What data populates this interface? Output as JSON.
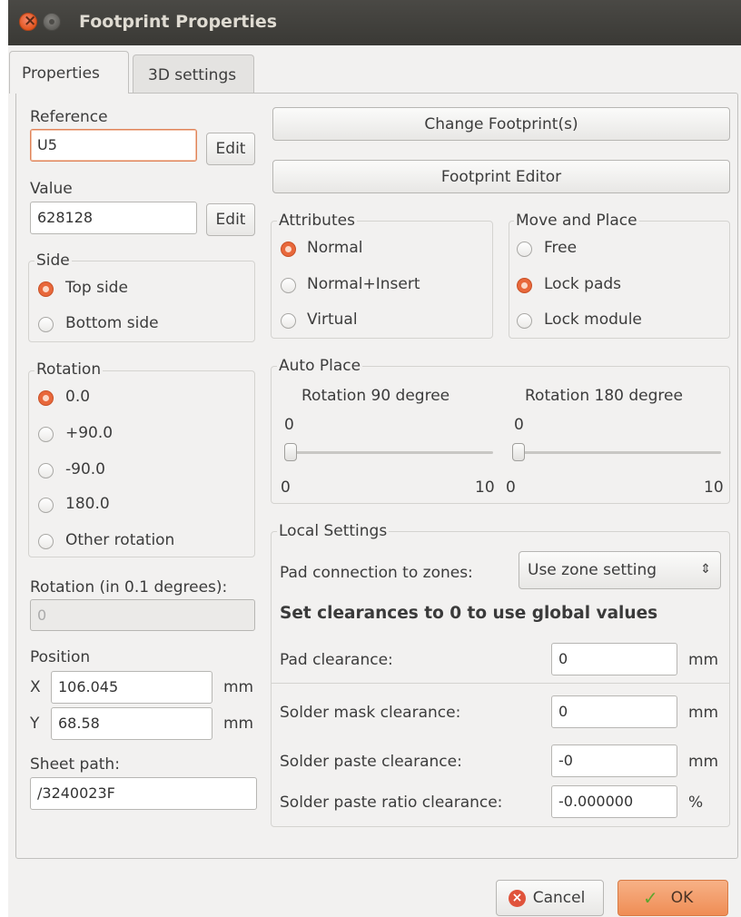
{
  "window": {
    "title": "Footprint Properties"
  },
  "tabs": [
    {
      "label": "Properties"
    },
    {
      "label": "3D settings"
    }
  ],
  "left": {
    "reference_label": "Reference",
    "reference_value": "U5",
    "reference_edit": "Edit",
    "value_label": "Value",
    "value_value": "628128",
    "value_edit": "Edit",
    "side": {
      "title": "Side",
      "options": [
        "Top side",
        "Bottom side"
      ],
      "selected": "Top side"
    },
    "rotation": {
      "title": "Rotation",
      "options": [
        "0.0",
        "+90.0",
        "-90.0",
        "180.0",
        "Other rotation"
      ],
      "selected": "0.0"
    },
    "rotation_custom_label": "Rotation (in 0.1 degrees):",
    "rotation_custom_value": "0",
    "position_label": "Position",
    "pos_x_label": "X",
    "pos_x_value": "106.045",
    "pos_x_unit": "mm",
    "pos_y_label": "Y",
    "pos_y_value": "68.58",
    "pos_y_unit": "mm",
    "sheet_path_label": "Sheet path:",
    "sheet_path_value": "/3240023F"
  },
  "right": {
    "change_footprint_button": "Change Footprint(s)",
    "footprint_editor_button": "Footprint Editor",
    "attributes": {
      "title": "Attributes",
      "options": [
        "Normal",
        "Normal+Insert",
        "Virtual"
      ],
      "selected": "Normal"
    },
    "move_place": {
      "title": "Move and Place",
      "options": [
        "Free",
        "Lock pads",
        "Lock module"
      ],
      "selected": "Lock pads"
    },
    "auto_place": {
      "title": "Auto Place",
      "rot90": {
        "label": "Rotation 90 degree",
        "value": "0",
        "min": "0",
        "max": "10"
      },
      "rot180": {
        "label": "Rotation 180 degree",
        "value": "0",
        "min": "0",
        "max": "10"
      }
    },
    "local": {
      "title": "Local Settings",
      "pad_conn_label": "Pad connection to zones:",
      "pad_conn_value": "Use zone setting",
      "heading": "Set clearances to 0 to use global values",
      "pad_clearance_label": "Pad clearance:",
      "pad_clearance_value": "0",
      "pad_clearance_unit": "mm",
      "solder_mask_label": "Solder mask clearance:",
      "solder_mask_value": "0",
      "solder_mask_unit": "mm",
      "solder_paste_label": "Solder paste clearance:",
      "solder_paste_value": "-0",
      "solder_paste_unit": "mm",
      "solder_paste_ratio_label": "Solder paste ratio clearance:",
      "solder_paste_ratio_value": "-0.000000",
      "solder_paste_ratio_unit": "%"
    }
  },
  "footer": {
    "cancel_label": "Cancel",
    "ok_label": "OK"
  },
  "colors": {
    "accent": "#e8683b",
    "titlebar": "#3c3b37",
    "ok_button": "#f39c6b"
  }
}
